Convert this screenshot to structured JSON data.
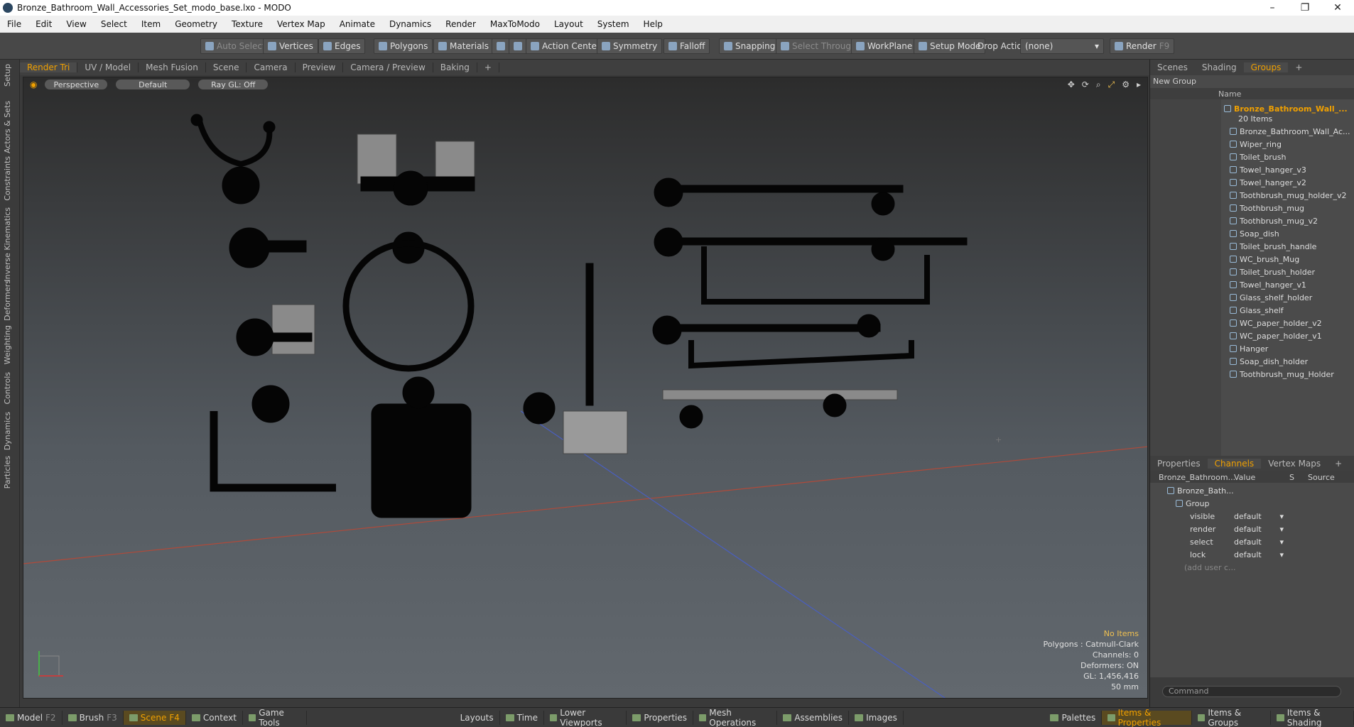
{
  "window": {
    "title": "Bronze_Bathroom_Wall_Accessories_Set_modo_base.lxo - MODO",
    "min": "–",
    "max": "❐",
    "close": "✕"
  },
  "menu": [
    "File",
    "Edit",
    "View",
    "Select",
    "Item",
    "Geometry",
    "Texture",
    "Vertex Map",
    "Animate",
    "Dynamics",
    "Render",
    "MaxToModo",
    "Layout",
    "System",
    "Help"
  ],
  "toolbar": {
    "auto_select": "Auto Select",
    "vertices": "Vertices",
    "edges": "Edges",
    "polygons": "Polygons",
    "materials": "Materials",
    "action_center": "Action Center",
    "symmetry": "Symmetry",
    "falloff": "Falloff",
    "snapping": "Snapping",
    "select_through": "Select Through",
    "workplane": "WorkPlane",
    "setup_mode": "Setup Mode",
    "drop_action": "Drop Action",
    "drop_value": "(none)",
    "render": "Render",
    "render_key": "F9"
  },
  "left_tabs": [
    "Setup",
    "Actors & Sets",
    "Constraints",
    "Inverse Kinematics",
    "Deformers",
    "Weighting",
    "Controls",
    "Dynamics",
    "Particles"
  ],
  "viewport_tabs": [
    "Render Tri",
    "UV / Model",
    "Mesh Fusion",
    "Scene",
    "Camera",
    "Preview",
    "Camera / Preview",
    "Baking",
    "+"
  ],
  "viewport": {
    "view": "Perspective",
    "shading": "Default",
    "raygl": "Ray GL: Off",
    "hud": {
      "selection": "No Items",
      "polygons": "Polygons : Catmull-Clark",
      "channels": "Channels: 0",
      "deformers": "Deformers: ON",
      "gl": "GL: 1,456,416",
      "scale": "50 mm"
    }
  },
  "right_tabs": [
    "Scenes",
    "Shading",
    "Groups",
    "+"
  ],
  "groups": {
    "new_group": "New Group",
    "name_col": "Name",
    "root": "Bronze_Bathroom_Wall_...",
    "count": "20 Items",
    "items": [
      "Bronze_Bathroom_Wall_Ac...",
      "Wiper_ring",
      "Toilet_brush",
      "Towel_hanger_v3",
      "Towel_hanger_v2",
      "Toothbrush_mug_holder_v2",
      "Toothbrush_mug",
      "Toothbrush_mug_v2",
      "Soap_dish",
      "Toilet_brush_handle",
      "WC_brush_Mug",
      "Toilet_brush_holder",
      "Towel_hanger_v1",
      "Glass_shelf_holder",
      "Glass_shelf",
      "WC_paper_holder_v2",
      "WC_paper_holder_v1",
      "Hanger",
      "Soap_dish_holder",
      "Toothbrush_mug_Holder"
    ]
  },
  "channels_tabs": [
    "Properties",
    "Channels",
    "Vertex Maps",
    "+"
  ],
  "channels": {
    "col_name": "Bronze_Bathroom...",
    "col_value": "Value",
    "col_s": "S",
    "col_source": "Source",
    "root": "Bronze_Bath...",
    "group": "Group",
    "rows": [
      {
        "name": "visible",
        "value": "default"
      },
      {
        "name": "render",
        "value": "default"
      },
      {
        "name": "select",
        "value": "default"
      },
      {
        "name": "lock",
        "value": "default"
      }
    ],
    "add": "(add user c..."
  },
  "command_placeholder": "Command",
  "bottom": {
    "model": "Model",
    "model_key": "F2",
    "brush": "Brush",
    "brush_key": "F3",
    "scene": "Scene",
    "scene_key": "F4",
    "context": "Context",
    "game_tools": "Game Tools",
    "layouts": "Layouts",
    "time": "Time",
    "lower_viewports": "Lower Viewports",
    "properties": "Properties",
    "mesh_operations": "Mesh Operations",
    "assemblies": "Assemblies",
    "images": "Images",
    "palettes": "Palettes",
    "items_properties": "Items & Properties",
    "items_groups": "Items & Groups",
    "items_shading": "Items & Shading"
  }
}
